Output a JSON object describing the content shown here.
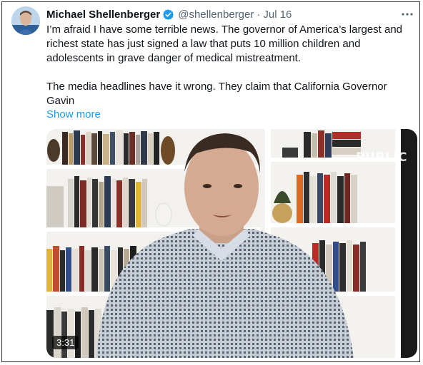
{
  "tweet": {
    "author_name": "Michael Shellenberger",
    "handle": "@shellenberger",
    "separator": "·",
    "date": "Jul 16",
    "paragraph1": "I’m afraid I have some terrible news. The governor of America’s largest and richest state has just signed a law that puts 10 million children and adolescents in grave danger of medical mistreatment.",
    "paragraph2": "The media headlines have it wrong. They claim that California Governor Gavin",
    "show_more": "Show more",
    "icons": {
      "verified": "verified-badge-icon",
      "more": "more-options-icon",
      "avatar": "avatar"
    },
    "colors": {
      "link": "#1d9bf0",
      "verified": "#1d9bf0",
      "secondary_text": "#536471"
    }
  },
  "media": {
    "duration": "3:31",
    "watermark": "PUBLIC"
  }
}
